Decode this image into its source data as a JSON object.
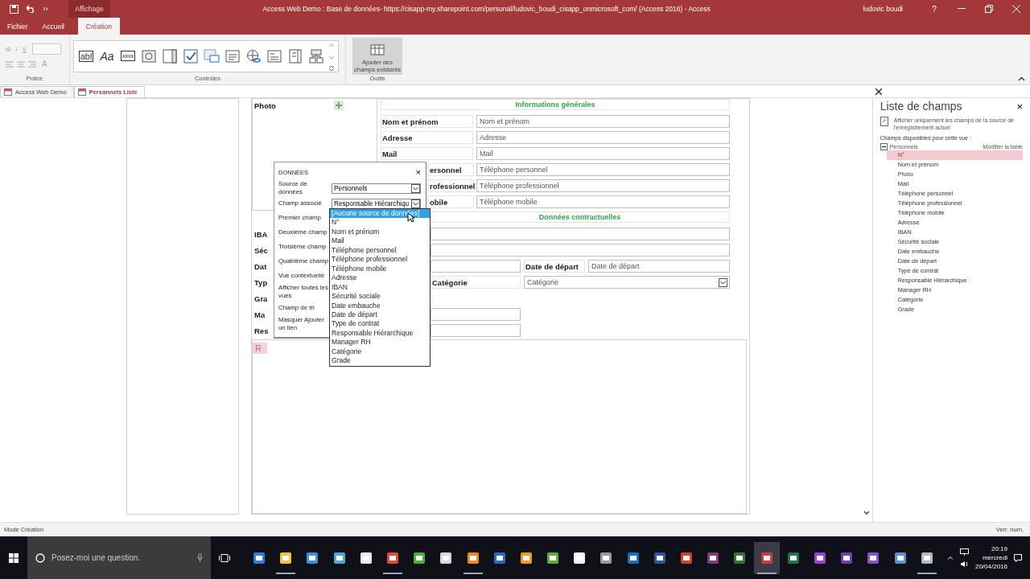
{
  "window": {
    "title": "Access Web Demo : Base de données- https://cisapp-my.sharepoint.com/personal/ludovic_boudi_cisapp_onmicrosoft_com/ (Access 2016) - Access",
    "user": "ludovic boudi",
    "help": "?",
    "context_tab": "Affichage"
  },
  "ribbon_tabs": [
    {
      "label": "Fichier",
      "selected": false
    },
    {
      "label": "Accueil",
      "selected": false
    },
    {
      "label": "Création",
      "selected": true
    }
  ],
  "ribbon": {
    "police": {
      "styles": [
        "G",
        "I",
        "S"
      ],
      "font_color": "A",
      "label": "Police"
    },
    "controls": {
      "label": "Contrôles",
      "gallery": [
        {
          "kind": "text",
          "glyph": "abl"
        },
        {
          "kind": "label",
          "glyph": "Aa"
        },
        {
          "kind": "mask",
          "glyph": "xxxx"
        },
        {
          "kind": "image"
        },
        {
          "kind": "combo"
        },
        {
          "kind": "check"
        },
        {
          "kind": "picture"
        },
        {
          "kind": "multiline"
        },
        {
          "kind": "hyperlink"
        },
        {
          "kind": "autocomplete"
        },
        {
          "kind": "listbox"
        },
        {
          "kind": "subview"
        }
      ]
    },
    "tools": {
      "label": "Outils",
      "button": "Ajouter des champs existants",
      "selected": true
    }
  },
  "doc_tabs": [
    {
      "label": "Access Web Demo",
      "selected": false
    },
    {
      "label": "Personnels Liste",
      "selected": true
    }
  ],
  "form": {
    "photo_label": "Photo",
    "header_1": "Informations générales",
    "rows_1": [
      {
        "label": "Nom et prénom",
        "placeholder": "Nom et prénom",
        "kind": "full"
      },
      {
        "label": "Adresse",
        "placeholder": "Adresse",
        "kind": "full"
      },
      {
        "label": "Mail",
        "placeholder": "Mail",
        "kind": "full"
      },
      {
        "label": "ersonnel",
        "placeholder": "Téléphone personnel",
        "kind": "partial"
      },
      {
        "label": "rofessionnel",
        "placeholder": "Téléphone professionnel",
        "kind": "partial"
      },
      {
        "label": "obile",
        "placeholder": "Téléphone mobile",
        "kind": "partial"
      }
    ],
    "header_2": "Données contractuelles",
    "rows_2": [
      {
        "label": "IBA",
        "kind": "wide"
      },
      {
        "label": "Séc",
        "kind": "wide"
      },
      {
        "label": "Dat",
        "kind": "split",
        "label_2": "Date de départ",
        "placeholder_2": "Date de départ"
      },
      {
        "label": "Typ",
        "kind": "select",
        "label_2": "Catégorie",
        "placeholder_2": "Catégorie"
      },
      {
        "label": "Gra",
        "kind": "empty"
      },
      {
        "label": "Ma",
        "kind": "short"
      },
      {
        "label": "Res",
        "kind": "short"
      }
    ],
    "subview_tab": "R"
  },
  "data_dialog": {
    "title": "DONNÉES",
    "close": "×",
    "rows": [
      {
        "label": "Source de données",
        "value": "Personnels"
      },
      {
        "label": "Champ associé",
        "value": "Responsable Hiérarchiqu"
      },
      {
        "label": "Premier champ"
      },
      {
        "label": "Deuxième champ"
      },
      {
        "label": "Troisième champ"
      },
      {
        "label": "Quatrième champ"
      },
      {
        "label": "Vue contextuelle"
      },
      {
        "label": "Afficher toutes les vues"
      },
      {
        "label": "Champ de tri"
      },
      {
        "label": "Masquer Ajouter un lien"
      }
    ]
  },
  "dropdown": [
    {
      "label": "[Aucune source de données]",
      "selected": true
    },
    {
      "label": "N°",
      "selected": false
    },
    {
      "label": "Nom et prénom",
      "selected": false
    },
    {
      "label": "Mail",
      "selected": false
    },
    {
      "label": "Téléphone personnel",
      "selected": false
    },
    {
      "label": "Téléphone professionnel",
      "selected": false
    },
    {
      "label": "Téléphone mobile",
      "selected": false
    },
    {
      "label": "Adresse",
      "selected": false
    },
    {
      "label": "IBAN",
      "selected": false
    },
    {
      "label": "Sécurité sociale",
      "selected": false
    },
    {
      "label": "Date embauche",
      "selected": false
    },
    {
      "label": "Date de départ",
      "selected": false
    },
    {
      "label": "Type de contrat",
      "selected": false
    },
    {
      "label": "Responsable Hiérarchique",
      "selected": false
    },
    {
      "label": "Manager RH",
      "selected": false
    },
    {
      "label": "Catégorie",
      "selected": false
    },
    {
      "label": "Grade",
      "selected": false
    }
  ],
  "field_list": {
    "title": "Liste de champs",
    "close": "×",
    "option": "Afficher uniquement les champs de la source de l'enregistrement actuel",
    "caption": "Champs disponibles pour cette vue :",
    "edit_link": "Modifier la table",
    "tree": [
      {
        "label": "Personnels",
        "expanded": true,
        "selected": false,
        "children": [
          {
            "label": "N°",
            "selected": true
          },
          {
            "label": "Nom et prénom",
            "selected": false
          },
          {
            "label": "Photo",
            "selected": false
          },
          {
            "label": "Mail",
            "selected": false
          },
          {
            "label": "Téléphone personnel",
            "selected": false
          },
          {
            "label": "Téléphone professionnel",
            "selected": false
          },
          {
            "label": "Téléphone mobile",
            "selected": false
          },
          {
            "label": "Adresse",
            "selected": false
          },
          {
            "label": "IBAN",
            "selected": false
          },
          {
            "label": "Sécurité sociale",
            "selected": false
          },
          {
            "label": "Date embauche",
            "selected": false
          },
          {
            "label": "Date de départ",
            "selected": false
          },
          {
            "label": "Type de contrat",
            "selected": false
          },
          {
            "label": "Responsable Hiérarchique",
            "selected": false
          },
          {
            "label": "Manager RH",
            "selected": false
          },
          {
            "label": "Catégorie",
            "selected": false
          },
          {
            "label": "Grade",
            "selected": false
          }
        ]
      }
    ]
  },
  "status_bar": {
    "left": "Mode Création",
    "right": "Verr. num."
  },
  "taskbar": {
    "search_placeholder": "Posez-moi une question.",
    "time": "20:19",
    "day": "mercredi",
    "date": "20/04/2016",
    "apps": [
      {
        "color": "#2f7fd8",
        "running": false,
        "selected": false
      },
      {
        "color": "#f2c14b",
        "running": true,
        "selected": false
      },
      {
        "color": "#3c8ee0",
        "running": false,
        "selected": false
      },
      {
        "color": "#4aa8d8",
        "running": false,
        "selected": false
      },
      {
        "color": "#e8e8e8",
        "running": false,
        "selected": false
      },
      {
        "color": "#e5483b",
        "running": true,
        "selected": false
      },
      {
        "color": "#4caf3a",
        "running": false,
        "selected": false
      },
      {
        "color": "#d8d8d8",
        "running": false,
        "selected": false
      },
      {
        "color": "#f08a1c",
        "running": true,
        "selected": false
      },
      {
        "color": "#2a6cc0",
        "running": false,
        "selected": false
      },
      {
        "color": "#f39a1e",
        "running": false,
        "selected": false
      },
      {
        "color": "#5fae3a",
        "running": false,
        "selected": false
      },
      {
        "color": "#f0f0f0",
        "running": false,
        "selected": false
      },
      {
        "color": "#9a9a9a",
        "running": false,
        "selected": false
      },
      {
        "color": "#1f6cc4",
        "running": false,
        "selected": false
      },
      {
        "color": "#2b579a",
        "running": false,
        "selected": false
      },
      {
        "color": "#d04525",
        "running": false,
        "selected": false
      },
      {
        "color": "#80397b",
        "running": false,
        "selected": false
      },
      {
        "color": "#31752f",
        "running": false,
        "selected": false
      },
      {
        "color": "#c43e3e",
        "running": true,
        "selected": true
      },
      {
        "color": "#217346",
        "running": false,
        "selected": false
      },
      {
        "color": "#9b3fd0",
        "running": false,
        "selected": false
      },
      {
        "color": "#6e3fb5",
        "running": false,
        "selected": false
      },
      {
        "color": "#8a4fd0",
        "running": false,
        "selected": false
      },
      {
        "color": "#5b8fd0",
        "running": false,
        "selected": false
      },
      {
        "color": "#b8b8b8",
        "running": true,
        "selected": false
      }
    ]
  }
}
